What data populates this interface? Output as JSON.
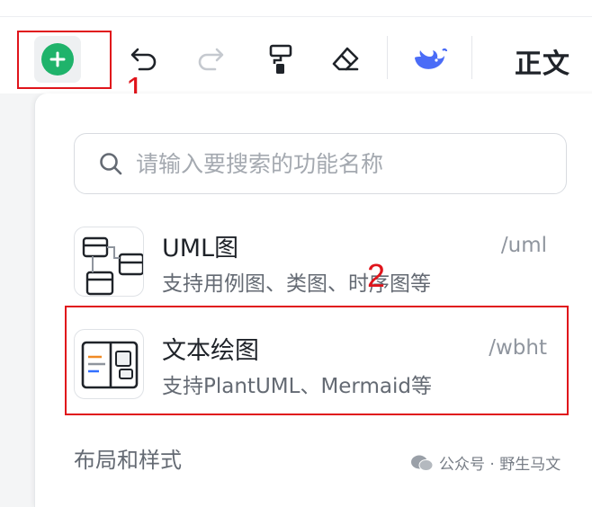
{
  "toolbar": {
    "style_label": "正文",
    "icons": [
      "add-icon",
      "undo-icon",
      "redo-icon",
      "format-painter-icon",
      "eraser-icon",
      "ai-whale-icon"
    ]
  },
  "annotations": {
    "step1": "1",
    "step2": "2",
    "color": "#e0141b"
  },
  "search": {
    "placeholder": "请输入要搜索的功能名称"
  },
  "items": [
    {
      "title": "UML图",
      "description": "支持用例图、类图、时序图等",
      "shortcut": "/uml",
      "icon": "uml-diagram-icon"
    },
    {
      "title": "文本绘图",
      "description": "支持PlantUML、Mermaid等",
      "shortcut": "/wbht",
      "icon": "text-diagram-icon"
    }
  ],
  "section": {
    "label": "布局和样式"
  },
  "watermark": {
    "text": "公众号 · 野生马文"
  },
  "colors": {
    "accent_green": "#1fb36b",
    "ai_blue": "#4a6cf7"
  }
}
